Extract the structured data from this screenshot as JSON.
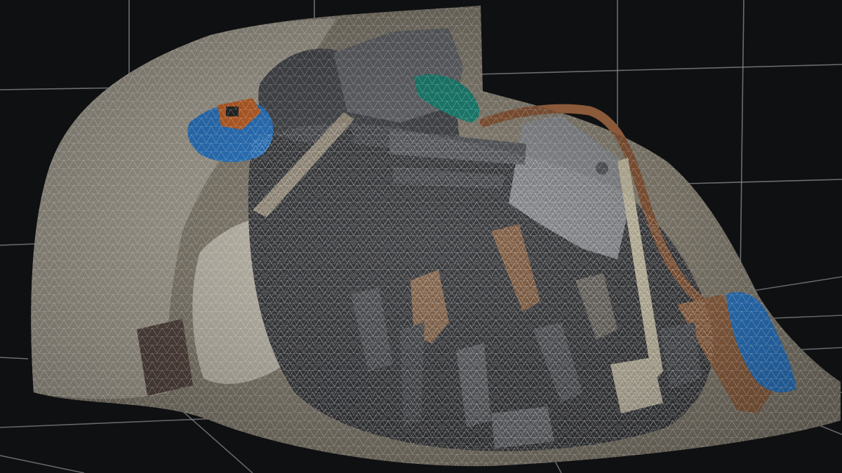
{
  "viewport": {
    "background_color": "#0f1012",
    "grid_color": "#8a8c90",
    "mesh_wire_color": "#ffffff"
  },
  "scan": {
    "subject": "photogrammetry-mesh-pile-of-rusty-tools",
    "palette": {
      "rust": "#8b5a3a",
      "steel": "#5a5c60",
      "cloth": "#b8b2a4",
      "blue_rag": "#2f7fd0",
      "teal_cloth": "#1e8a7a",
      "orange_part": "#d06a2c"
    }
  }
}
